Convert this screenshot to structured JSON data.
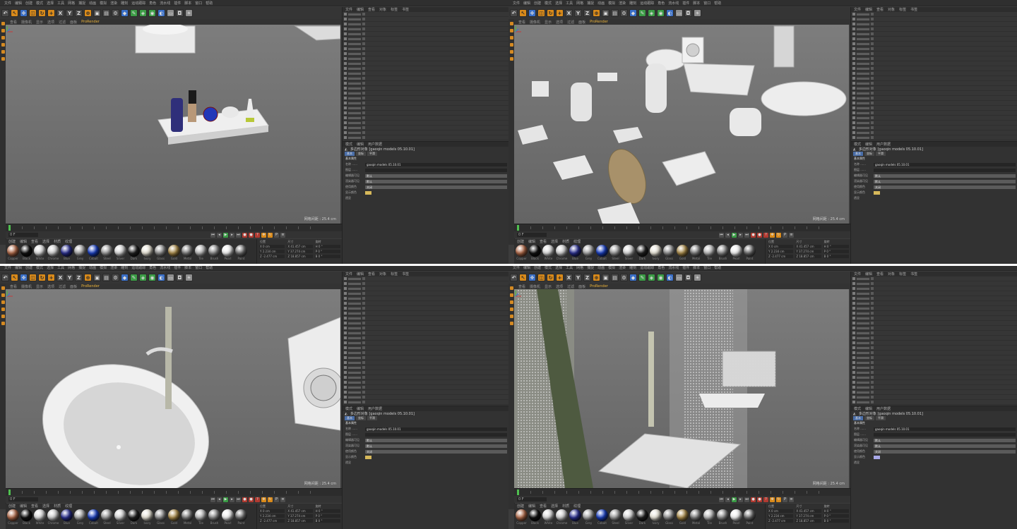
{
  "menu": [
    "文件",
    "编辑",
    "创建",
    "模式",
    "选择",
    "工具",
    "网格",
    "捕捉",
    "动画",
    "模拟",
    "渲染",
    "雕刻",
    "运动跟踪",
    "角色",
    "流水线",
    "插件",
    "脚本",
    "窗口",
    "帮助"
  ],
  "toolbar_xyz": [
    "X",
    "Y",
    "Z"
  ],
  "viewport_menu": [
    "查看",
    "摄像机",
    "显示",
    "选项",
    "过滤",
    "面板",
    "ProRender"
  ],
  "object_tabs": [
    "文件",
    "编辑",
    "查看",
    "对象",
    "标签",
    "书签"
  ],
  "attr_tabs": [
    "模式",
    "编辑",
    "用户数据"
  ],
  "attr_title": "多边形对象 [gaoqin models 05.10.01]",
  "attr_modes": [
    "基本",
    "坐标",
    "平滑"
  ],
  "attr_section": "基本属性",
  "attr_rows": [
    {
      "k": "名称 ......",
      "v": "gaoqin models 05.10.01"
    },
    {
      "k": "图层 ......",
      "v": ""
    },
    {
      "k": "编辑器可见",
      "v": "默认"
    },
    {
      "k": "渲染器可见",
      "v": "默认"
    },
    {
      "k": "使用颜色",
      "v": "关闭"
    },
    {
      "k": "显示颜色",
      "v": ""
    },
    {
      "k": "透显",
      "v": ""
    }
  ],
  "scale_label": "网格间距 : 25.4 cm",
  "frame_field": "0 F",
  "material_tabs": [
    "创建",
    "编辑",
    "查看",
    "选择",
    "材质",
    "纹理"
  ],
  "material_balls": [
    {
      "label": "Copper",
      "color": "#b06a4a"
    },
    {
      "label": "Black",
      "color": "#111111"
    },
    {
      "label": "White",
      "color": "#dcdcdc"
    },
    {
      "label": "Chrome",
      "color": "#cfcfcf"
    },
    {
      "label": "Blue",
      "color": "#2a2f8f"
    },
    {
      "label": "Grey",
      "color": "#a6a6a6"
    },
    {
      "label": "Cobalt",
      "color": "#1a3fbf"
    },
    {
      "label": "Steel",
      "color": "#9a9a9a"
    },
    {
      "label": "Silver",
      "color": "#d7d7d7"
    },
    {
      "label": "Dark",
      "color": "#222222"
    },
    {
      "label": "Ivory",
      "color": "#e9e5d8"
    },
    {
      "label": "Glass",
      "color": "#8e8e8e"
    },
    {
      "label": "Gold",
      "color": "#a88a4a"
    },
    {
      "label": "Metal",
      "color": "#7c7c7c"
    },
    {
      "label": "Tile",
      "color": "#b8b8b8"
    },
    {
      "label": "Brush",
      "color": "#888888"
    },
    {
      "label": "Pearl",
      "color": "#f1f1f1"
    },
    {
      "label": "Paint",
      "color": "#6d6d6d"
    }
  ],
  "coord_labels": [
    "位置",
    "尺寸",
    "旋转"
  ],
  "coord_rows": [
    [
      "X  0 cm",
      "X  41.457 cm",
      "H  0 °"
    ],
    [
      "Y  2.234 cm",
      "Y  37.274 cm",
      "P  0 °"
    ],
    [
      "Z  -2.477 cm",
      "Z  18.857 cm",
      "B  0 °"
    ]
  ],
  "swatch_colors": [
    "#d6b85a",
    "#d6b85a",
    "#d6b85a",
    "#a8a8e8"
  ]
}
